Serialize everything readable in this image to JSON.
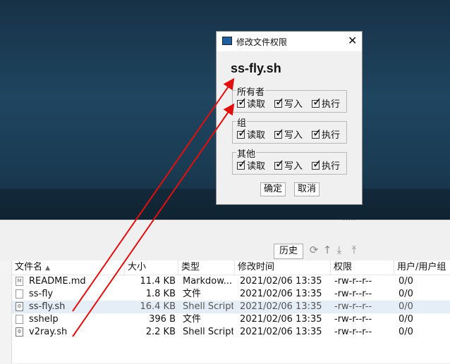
{
  "dialog": {
    "title": "修改文件权限",
    "filename": "ss-fly.sh",
    "groups": [
      {
        "label": "所有者",
        "read": "读取",
        "write": "写入",
        "exec": "执行"
      },
      {
        "label": "组",
        "read": "读取",
        "write": "写入",
        "exec": "执行"
      },
      {
        "label": "其他",
        "read": "读取",
        "write": "写入",
        "exec": "执行"
      }
    ],
    "ok": "确定",
    "cancel": "取消"
  },
  "toolbar": {
    "history": "历史",
    "drag_dots": "....."
  },
  "table": {
    "headers": {
      "name": "文件名",
      "sort": "▲",
      "size": "大小",
      "type": "类型",
      "mtime": "修改时间",
      "perm": "权限",
      "owner": "用户/用户组"
    },
    "rows": [
      {
        "name": "README.md",
        "size": "11.4 KB",
        "type": "Markdow...",
        "mtime": "2021/02/06 13:35",
        "perm": "-rw-r--r--",
        "owner": "0/0"
      },
      {
        "name": "ss-fly",
        "size": "1.8 KB",
        "type": "文件",
        "mtime": "2021/02/06 13:35",
        "perm": "-rw-r--r--",
        "owner": "0/0"
      },
      {
        "name": "ss-fly.sh",
        "size": "16.4 KB",
        "type": "Shell Script",
        "mtime": "2021/02/06 13:35",
        "perm": "-rw-r--r--",
        "owner": "0/0"
      },
      {
        "name": "sshelp",
        "size": "396 B",
        "type": "文件",
        "mtime": "2021/02/06 13:35",
        "perm": "-rw-r--r--",
        "owner": "0/0"
      },
      {
        "name": "v2ray.sh",
        "size": "2.2 KB",
        "type": "Shell Script",
        "mtime": "2021/02/06 13:35",
        "perm": "-rw-r--r--",
        "owner": "0/0"
      }
    ]
  },
  "colors": {
    "arrow": "#e01010",
    "selected_row": "#e5eef7"
  }
}
